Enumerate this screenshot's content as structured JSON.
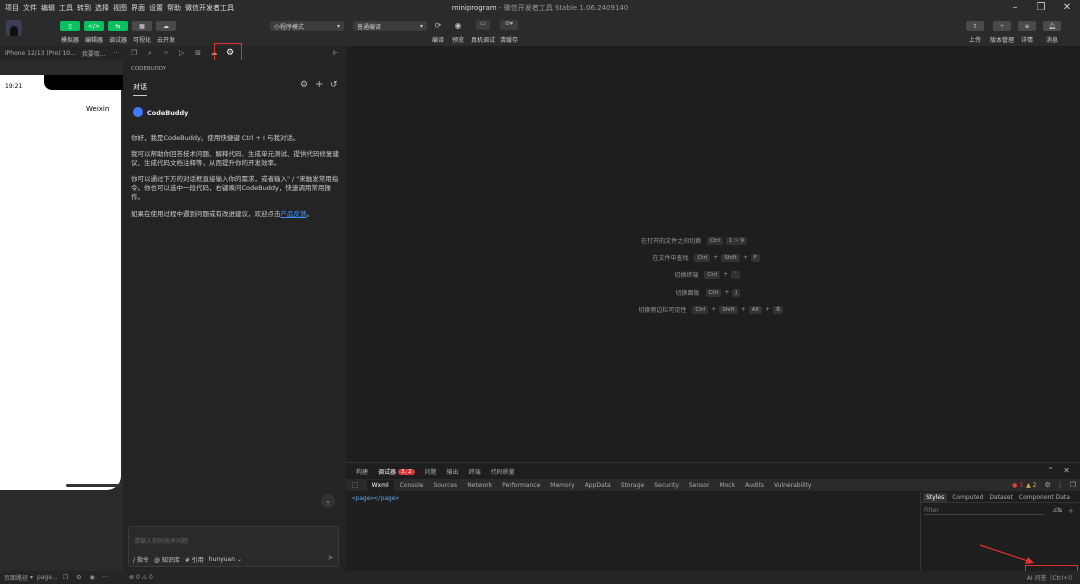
{
  "menubar": {
    "items": [
      "项目",
      "文件",
      "编辑",
      "工具",
      "转到",
      "选择",
      "视图",
      "界面",
      "设置",
      "帮助",
      "微信开发者工具"
    ],
    "title_main": "miniprogram",
    "title_sub": " - 微信开发者工具 Stable 1.06.2409140"
  },
  "toolbar": {
    "buttons": [
      {
        "label": "模拟器",
        "glyph": "▯"
      },
      {
        "label": "编辑器",
        "glyph": "</>"
      },
      {
        "label": "调试器",
        "glyph": "⇆"
      },
      {
        "label": "可视化",
        "glyph": "▦"
      },
      {
        "label": "云开发",
        "glyph": "☁"
      }
    ],
    "mode_select": "小程序模式",
    "compile_select": "普通编译",
    "actions": [
      "编译",
      "预览",
      "真机调试",
      "清缓存"
    ],
    "right_actions": [
      "上传",
      "版本管理",
      "详情",
      "消息"
    ]
  },
  "simulator": {
    "device": "iPhone 12/13 (Pro) 10...",
    "scale": "我要取...",
    "more": "···",
    "time": "19:21",
    "nav_title": "Weixin"
  },
  "codebuddy": {
    "section": "CODEBUDDY",
    "tab": "对话",
    "brand": "CodeBuddy",
    "p1": "你好，我是CodeBuddy。使用快捷键 Ctrl + I 与我对话。",
    "p2": "我可以帮助你回答技术问题、解释代码、生成单元测试、提供代码修复建议、生成代码文档注释等，从而提升你的开发效率。",
    "p3": "你可以通过下方的对话框直接输入你的需求，或者输入\" / \"来触发常用指令。你也可以选中一段代码，右键唤问CodeBuddy，快速调用常用操作。",
    "p4_pre": "如果在使用过程中遇到问题或有改进建议，欢迎点击",
    "p4_link": "产品反馈",
    "p4_post": "。",
    "input_placeholder": "请输入你的技术问题",
    "cmd": "/ 指令",
    "kb": "@ 知识库",
    "ref": "# 引用",
    "model": "hunyuan"
  },
  "editor": {
    "shortcuts": [
      {
        "label": "在打开的文件之间切换",
        "keys": [
          "Ctrl",
          "1 ~ 9"
        ]
      },
      {
        "label": "在文件中查找",
        "keys": [
          "Ctrl",
          "+",
          "Shift",
          "+",
          "F"
        ]
      },
      {
        "label": "切换终端",
        "keys": [
          "Ctrl",
          "+",
          "`"
        ]
      },
      {
        "label": "切换面板",
        "keys": [
          "Ctrl",
          "+",
          "J"
        ]
      },
      {
        "label": "切换侧边栏可见性",
        "keys": [
          "Ctrl",
          "+",
          "Shift",
          "+",
          "Alt",
          "+",
          "B"
        ]
      }
    ]
  },
  "devtools": {
    "panel_tabs": [
      "构建",
      "调试器",
      "问题",
      "输出",
      "终端",
      "代码质量"
    ],
    "debug_badge": "3, 2",
    "tabs": [
      "Wxml",
      "Console",
      "Sources",
      "Network",
      "Performance",
      "Memory",
      "AppData",
      "Storage",
      "Security",
      "Sensor",
      "Mock",
      "Audits",
      "Vulnerability"
    ],
    "errors": "3",
    "warnings": "2",
    "wxml_line": "<page></page>",
    "style_tabs": [
      "Styles",
      "Computed",
      "Dataset",
      "Component Data"
    ],
    "filter_placeholder": "Filter",
    "cls": ".cls"
  },
  "status": {
    "path_label": "页面路径",
    "path": "page...",
    "errors": "0",
    "warnings": "0",
    "ai_tip": "AI 问答（Ctrl+I）"
  },
  "colors": {
    "brand_green": "#07c160",
    "highlight_red": "#e03030",
    "link": "#3794ff"
  }
}
